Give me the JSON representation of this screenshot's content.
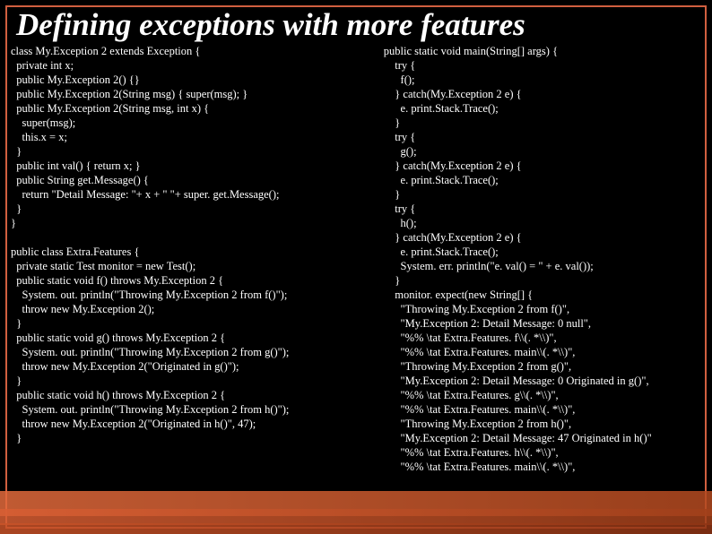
{
  "title": "Defining exceptions with more features",
  "code_left": "class My.Exception 2 extends Exception {\n  private int x;\n  public My.Exception 2() {}\n  public My.Exception 2(String msg) { super(msg); }\n  public My.Exception 2(String msg, int x) {\n    super(msg);\n    this.x = x;\n  }\n  public int val() { return x; }\n  public String get.Message() {\n    return \"Detail Message: \"+ x + \" \"+ super. get.Message();\n  }\n}\n\npublic class Extra.Features {\n  private static Test monitor = new Test();\n  public static void f() throws My.Exception 2 {\n    System. out. println(\"Throwing My.Exception 2 from f()\");\n    throw new My.Exception 2();\n  }\n  public static void g() throws My.Exception 2 {\n    System. out. println(\"Throwing My.Exception 2 from g()\");\n    throw new My.Exception 2(\"Originated in g()\");\n  }\n  public static void h() throws My.Exception 2 {\n    System. out. println(\"Throwing My.Exception 2 from h()\");\n    throw new My.Exception 2(\"Originated in h()\", 47);\n  }",
  "code_right": "public static void main(String[] args) {\n    try {\n      f();\n    } catch(My.Exception 2 e) {\n      e. print.Stack.Trace();\n    }\n    try {\n      g();\n    } catch(My.Exception 2 e) {\n      e. print.Stack.Trace();\n    }\n    try {\n      h();\n    } catch(My.Exception 2 e) {\n      e. print.Stack.Trace();\n      System. err. println(\"e. val() = \" + e. val());\n    }\n    monitor. expect(new String[] {\n      \"Throwing My.Exception 2 from f()\",\n      \"My.Exception 2: Detail Message: 0 null\",\n      \"%% \\tat Extra.Features. f\\\\(. *\\\\)\",\n      \"%% \\tat Extra.Features. main\\\\(. *\\\\)\",\n      \"Throwing My.Exception 2 from g()\",\n      \"My.Exception 2: Detail Message: 0 Originated in g()\",\n      \"%% \\tat Extra.Features. g\\\\(. *\\\\)\",\n      \"%% \\tat Extra.Features. main\\\\(. *\\\\)\",\n      \"Throwing My.Exception 2 from h()\",\n      \"My.Exception 2: Detail Message: 47 Originated in h()\"\n      \"%% \\tat Extra.Features. h\\\\(. *\\\\)\",\n      \"%% \\tat Extra.Features. main\\\\(. *\\\\)\","
}
